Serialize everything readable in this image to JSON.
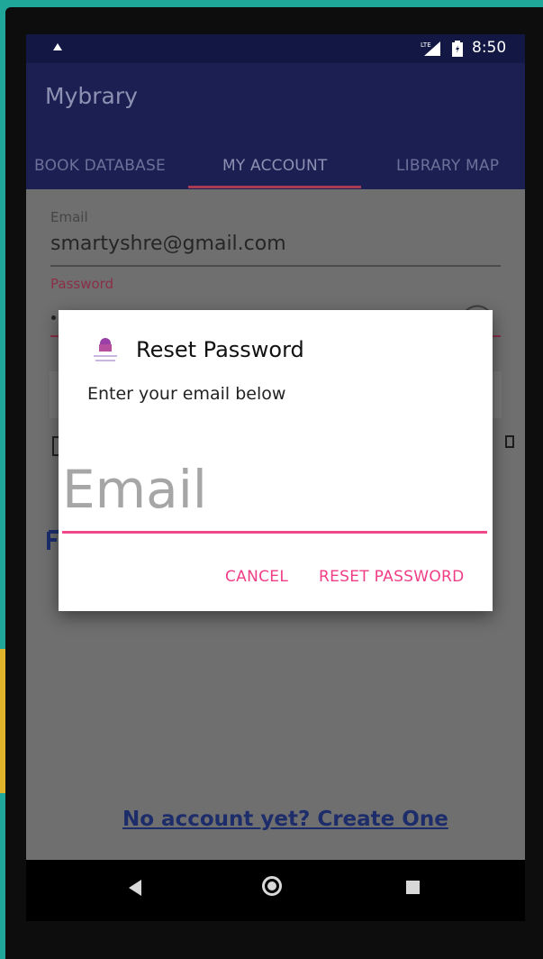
{
  "status_bar": {
    "time": "8:50",
    "icons": [
      "notification-icon",
      "lte-signal-icon",
      "battery-icon"
    ]
  },
  "app": {
    "title": "Mybrary"
  },
  "tabs": [
    {
      "label": "BOOK DATABASE"
    },
    {
      "label": "MY ACCOUNT",
      "selected": true
    },
    {
      "label": "LIBRARY MAP"
    }
  ],
  "form": {
    "email_label": "Email",
    "email_value": "smartyshre@gmail.com",
    "password_label": "Password",
    "create_account_link": "No account yet? Create One"
  },
  "dialog": {
    "title": "Reset Password",
    "message": "Enter your email below",
    "input_placeholder": "Email",
    "cancel_label": "CANCEL",
    "reset_label": "RESET PASSWORD"
  },
  "colors": {
    "app_bar": "#1b1f52",
    "accent": "#f03e86",
    "device_background": "#1fa89a"
  }
}
